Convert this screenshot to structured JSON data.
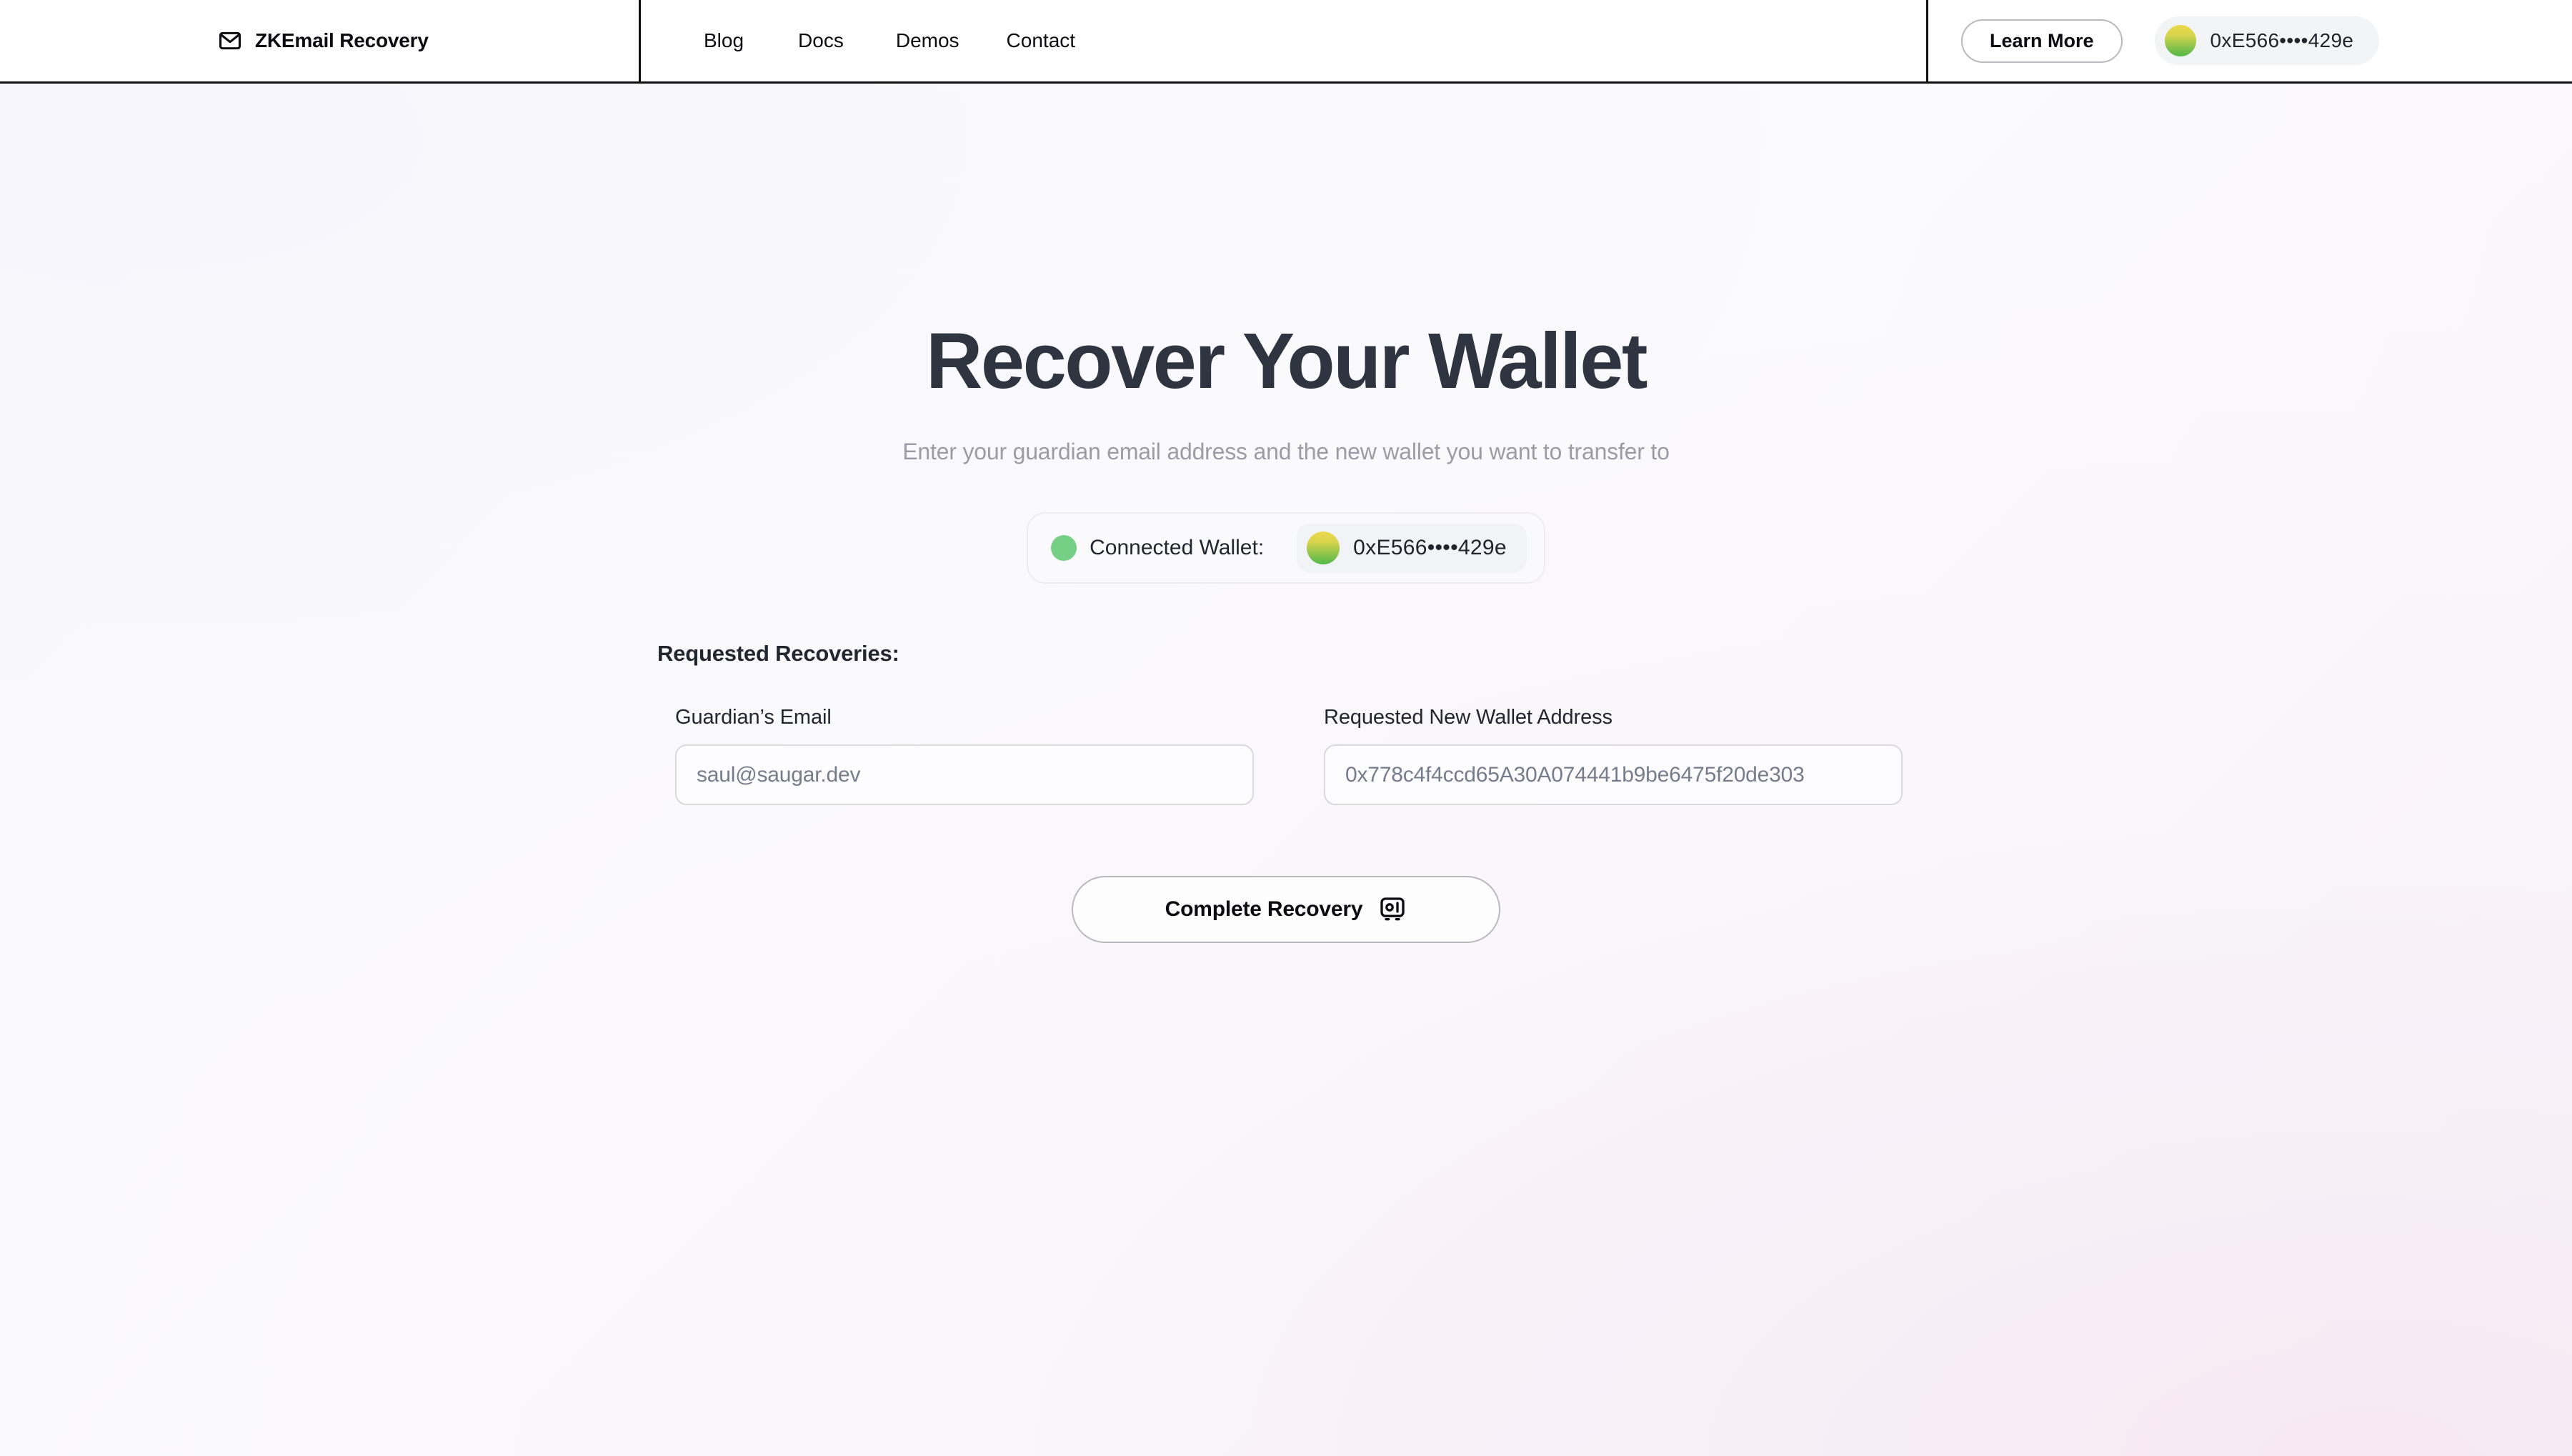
{
  "header": {
    "brand": {
      "icon": "envelope-icon",
      "name": "ZKEmail Recovery"
    },
    "nav": [
      {
        "label": "Blog"
      },
      {
        "label": "Docs"
      },
      {
        "label": "Demos"
      },
      {
        "label": "Contact"
      }
    ],
    "learn_more_label": "Learn More",
    "wallet": {
      "address": "0xE566••••429e",
      "avatar_gradient_from": "#ECD94B",
      "avatar_gradient_to": "#52B847"
    }
  },
  "main": {
    "title": "Recover Your Wallet",
    "subtitle": "Enter your guardian email address and the new wallet you want to transfer to",
    "connected_wallet": {
      "status_label": "Connected Wallet:",
      "status_color": "#75CF85",
      "address": "0xE566••••429e"
    },
    "form": {
      "heading": "Requested Recoveries:",
      "fields": [
        {
          "label": "Guardian’s Email",
          "value": "saul@saugar.dev",
          "placeholder": "saul@saugar.dev"
        },
        {
          "label": "Requested New Wallet Address",
          "value": "0x778c4f4ccd65A30A074441b9be6475f20de303",
          "placeholder": "0x778c4f4ccd65A30A074441b9be6475f20de303"
        }
      ],
      "submit_label": "Complete Recovery",
      "submit_icon": "vault-icon"
    }
  },
  "colors": {
    "title": "#2E3440",
    "subtitle": "#9C9CA4",
    "text": "#22262E",
    "input_text": "#757D8D",
    "border": "#D9D9DE"
  }
}
